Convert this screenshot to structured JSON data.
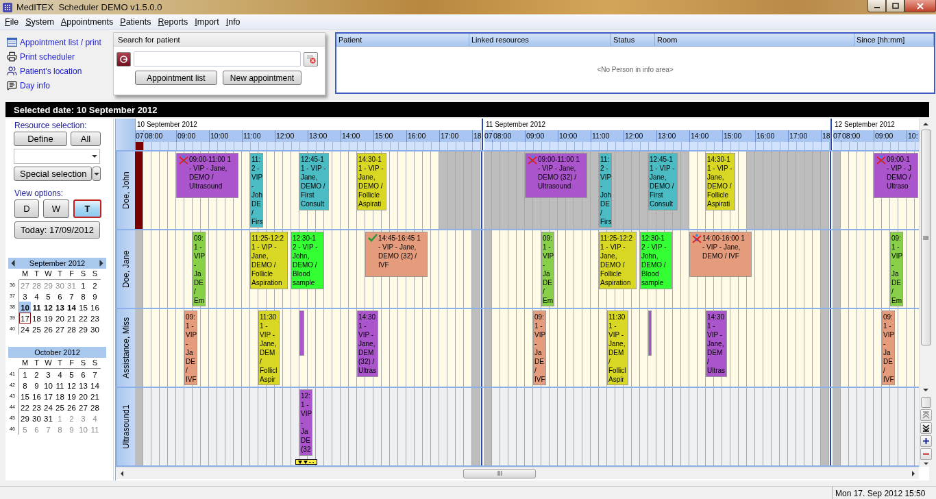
{
  "window": {
    "title": "MedITEX  Scheduler DEMO v1.5.0.0"
  },
  "menu": [
    "File",
    "System",
    "Appointments",
    "Patients",
    "Reports",
    "Import",
    "Info"
  ],
  "quick_links": [
    "Appointment list / print",
    "Print scheduler",
    "Patient's location",
    "Day info"
  ],
  "search": {
    "title": "Search for patient",
    "buttons": [
      "Appointment list",
      "New appointment"
    ]
  },
  "info_table": {
    "columns": [
      "Patient",
      "Linked resources",
      "Status",
      "Room",
      "Since [hh:mm]"
    ],
    "empty_text": "<No Person in info area>"
  },
  "selected_date": "Selected date: 10 September 2012",
  "resource_selection": {
    "label": "Resource selection:",
    "buttons": [
      "Define",
      "All"
    ],
    "special": "Special selection"
  },
  "view_options": {
    "label": "View options:",
    "buttons": [
      {
        "label": "D",
        "selected": false
      },
      {
        "label": "W",
        "selected": false
      },
      {
        "label": "T",
        "selected": true
      }
    ],
    "today": "Today: 17/09/2012"
  },
  "calendars": [
    {
      "title": "September 2012",
      "arrows": true,
      "weekdays": [
        "M",
        "T",
        "W",
        "T",
        "F",
        "S",
        "S"
      ],
      "weeks": [
        {
          "week": "36",
          "days": [
            {
              "d": "27",
              "muted": true,
              "selected": false
            },
            {
              "d": "28",
              "muted": true,
              "selected": false
            },
            {
              "d": "29",
              "muted": true,
              "selected": false
            },
            {
              "d": "30",
              "muted": true,
              "selected": false
            },
            {
              "d": "31",
              "muted": true,
              "selected": false
            },
            {
              "d": "1",
              "selected": false
            },
            {
              "d": "2",
              "selected": false
            }
          ]
        },
        {
          "week": "37",
          "days": [
            {
              "d": "3",
              "selected": false
            },
            {
              "d": "4",
              "selected": false
            },
            {
              "d": "5",
              "selected": false
            },
            {
              "d": "6",
              "selected": false
            },
            {
              "d": "7",
              "selected": false
            },
            {
              "d": "8",
              "selected": false
            },
            {
              "d": "9",
              "selected": false
            }
          ]
        },
        {
          "week": "38",
          "days": [
            {
              "d": "10",
              "bold": true,
              "selected": true
            },
            {
              "d": "11",
              "bold": true,
              "selected": false
            },
            {
              "d": "12",
              "bold": true,
              "selected": false
            },
            {
              "d": "13",
              "bold": true,
              "selected": false
            },
            {
              "d": "14",
              "bold": true,
              "selected": false
            },
            {
              "d": "15",
              "selected": false
            },
            {
              "d": "16",
              "selected": false
            }
          ]
        },
        {
          "week": "39",
          "days": [
            {
              "d": "17",
              "today": true,
              "selected": false
            },
            {
              "d": "18",
              "selected": false
            },
            {
              "d": "19",
              "selected": false
            },
            {
              "d": "20",
              "selected": false
            },
            {
              "d": "21",
              "selected": false
            },
            {
              "d": "22",
              "selected": false
            },
            {
              "d": "23",
              "selected": false
            }
          ]
        },
        {
          "week": "40",
          "days": [
            {
              "d": "24",
              "selected": false
            },
            {
              "d": "25",
              "selected": false
            },
            {
              "d": "26",
              "selected": false
            },
            {
              "d": "27",
              "selected": false
            },
            {
              "d": "28",
              "selected": false
            },
            {
              "d": "29",
              "selected": false
            },
            {
              "d": "30",
              "selected": false
            }
          ]
        }
      ]
    },
    {
      "title": "October 2012",
      "arrows": false,
      "weekdays": [
        "M",
        "T",
        "W",
        "T",
        "F",
        "S",
        "S"
      ],
      "weeks": [
        {
          "week": "41",
          "days": [
            {
              "d": "1",
              "selected": false
            },
            {
              "d": "2",
              "selected": false
            },
            {
              "d": "3",
              "selected": false
            },
            {
              "d": "4",
              "selected": false
            },
            {
              "d": "5",
              "selected": false
            },
            {
              "d": "6",
              "selected": false
            },
            {
              "d": "7",
              "selected": false
            }
          ]
        },
        {
          "week": "42",
          "days": [
            {
              "d": "8",
              "selected": false
            },
            {
              "d": "9",
              "selected": false
            },
            {
              "d": "10",
              "selected": false
            },
            {
              "d": "11",
              "selected": false
            },
            {
              "d": "12",
              "selected": false
            },
            {
              "d": "13",
              "selected": false
            },
            {
              "d": "14",
              "selected": false
            }
          ]
        },
        {
          "week": "43",
          "days": [
            {
              "d": "15",
              "selected": false
            },
            {
              "d": "16",
              "selected": false
            },
            {
              "d": "17",
              "selected": false
            },
            {
              "d": "18",
              "selected": false
            },
            {
              "d": "19",
              "selected": false
            },
            {
              "d": "20",
              "selected": false
            },
            {
              "d": "21",
              "selected": false
            }
          ]
        },
        {
          "week": "44",
          "days": [
            {
              "d": "22",
              "selected": false
            },
            {
              "d": "23",
              "selected": false
            },
            {
              "d": "24",
              "selected": false
            },
            {
              "d": "25",
              "selected": false
            },
            {
              "d": "26",
              "selected": false
            },
            {
              "d": "27",
              "selected": false
            },
            {
              "d": "28",
              "selected": false
            }
          ]
        },
        {
          "week": "45",
          "days": [
            {
              "d": "29",
              "selected": false
            },
            {
              "d": "30",
              "selected": false
            },
            {
              "d": "31",
              "selected": false
            },
            {
              "d": "1",
              "muted": true,
              "selected": false
            },
            {
              "d": "2",
              "muted": true,
              "selected": false
            },
            {
              "d": "3",
              "muted": true,
              "selected": false
            },
            {
              "d": "4",
              "muted": true,
              "selected": false
            }
          ]
        },
        {
          "week": "46",
          "days": [
            {
              "d": "5",
              "muted": true,
              "selected": false
            },
            {
              "d": "6",
              "muted": true,
              "selected": false
            },
            {
              "d": "7",
              "muted": true,
              "selected": false
            },
            {
              "d": "8",
              "muted": true,
              "selected": false
            },
            {
              "d": "9",
              "muted": true,
              "selected": false
            },
            {
              "d": "10",
              "muted": true,
              "selected": false
            },
            {
              "d": "11",
              "muted": true,
              "selected": false
            }
          ]
        }
      ]
    }
  ],
  "scheduler": {
    "days": [
      {
        "label": "10 September 2012",
        "marked": true,
        "hours": [
          "07",
          "08:00",
          "09:00",
          "10:00",
          "11:00",
          "12:00",
          "13:00",
          "14:00",
          "15:00",
          "16:00",
          "17:00",
          "18"
        ]
      },
      {
        "label": "11 September 2012",
        "marked": false,
        "hours": [
          "07",
          "08:00",
          "09:00",
          "10:00",
          "11:00",
          "12:00",
          "13:00",
          "14:00",
          "15:00",
          "16:00",
          "17:00",
          "18"
        ]
      },
      {
        "label": "12 September 2012",
        "marked": false,
        "hours": [
          "07",
          "08:00",
          "09:00",
          "10:"
        ]
      }
    ],
    "resources": [
      {
        "name": "Doe, John",
        "kind": "person",
        "days": [
          {
            "marker": true,
            "appointments": [
              {
                "kind": "cancelled",
                "color": "#aa55cc",
                "text": "09:00-11:00 1\n- VIP - Jane,\nDEMO /\nUltrasound"
              },
              {
                "kind": "plain",
                "color": "#4cbcc4",
                "text": "11:\n2 -\nVIP\n-\nJoh\nDE\n/\nFirs"
              },
              {
                "kind": "plain",
                "color": "#4cbcc4",
                "text": "12:45-1\n1 - VIP -\nJane,\nDEMO /\nFirst\nConsult"
              },
              {
                "kind": "plain",
                "color": "#d8d824",
                "text": "14:30-1\n1 - VIP -\nJane,\nDEMO /\nFollicle\nAspirati"
              }
            ]
          },
          {
            "marker": false,
            "appointments": [
              {
                "kind": "cancelled",
                "color": "#aa55cc",
                "text": "09:00-11:00 1\n- VIP - Jane,\nDEMO (32) /\nUltrasound"
              },
              {
                "kind": "plain",
                "color": "#4cbcc4",
                "text": "11:\n2 -\nVIP\n-\nJoh\nDE\n/\nFirs"
              },
              {
                "kind": "plain",
                "color": "#4cbcc4",
                "text": "12:45-1\n1 - VIP -\nJane,\nDEMO /\nFirst\nConsult"
              },
              {
                "kind": "plain",
                "color": "#d8d824",
                "text": "14:30-1\n1 - VIP -\nJane,\nDEMO /\nFollicle\nAspirati"
              }
            ]
          },
          {
            "marker": false,
            "appointments": [
              {
                "kind": "cancelled",
                "color": "#aa55cc",
                "text": "09:00-1\n- VIP - J\nDEMO /\nUltraso"
              }
            ]
          }
        ]
      },
      {
        "name": "Doe, Jane",
        "kind": "person",
        "days": [
          {
            "marker": false,
            "appointments": [
              {
                "kind": "plain",
                "color": "#88d048",
                "text": "09:\n1 -\nVIP\n-\nJa\nDE\n/\nEm"
              },
              {
                "kind": "plain",
                "color": "#d8d824",
                "text": "11:25-12:2\n1 - VIP -\nJane,\nDEMO /\nFollicle\nAspiration"
              },
              {
                "kind": "plain",
                "color": "#33ff33",
                "text": "12:30-1\n2 - VIP -\nJohn,\nDEMO /\nBlood\nsample"
              },
              {
                "kind": "done",
                "color": "#e49c7c",
                "text": "14:45-16:45 1\n- VIP - Jane,\nDEMO (32) /\nIVF"
              }
            ]
          },
          {
            "marker": false,
            "appointments": [
              {
                "kind": "plain",
                "color": "#88d048",
                "text": "09:\n1 -\nVIP\n-\nJa\nDE\n/\nEm"
              },
              {
                "kind": "plain",
                "color": "#d8d824",
                "text": "11:25-12:2\n1 - VIP -\nJane,\nDEMO /\nFollicle\nAspiration"
              },
              {
                "kind": "plain",
                "color": "#33ff33",
                "text": "12:30-1\n2 - VIP -\nJohn,\nDEMO /\nBlood\nsample"
              },
              {
                "kind": "cancelled",
                "color": "#e49c7c",
                "text": "14:00-16:00 1\n- VIP - Jane,\nDEMO / IVF"
              }
            ]
          },
          {
            "marker": false,
            "appointments": [
              {
                "kind": "plain",
                "color": "#88d048",
                "text": "09:\n1 -\nVIP\n-\nJa\nDE\n/\nEm"
              }
            ]
          }
        ]
      },
      {
        "name": "Assistance, Miss",
        "kind": "person",
        "days": [
          {
            "marker": false,
            "appointments": [
              {
                "kind": "plain",
                "color": "#e49c7c",
                "text": "09:\n1 -\nVIP\n-\nJa\nDE\n/\nIVF"
              },
              {
                "kind": "plain",
                "color": "#d8d824",
                "text": "11:30\n1 -\nVIP -\nJane,\nDEM\n/\nFollicl\nAspir"
              },
              {
                "kind": "plain",
                "color": "#aa55cc"
              },
              {
                "kind": "plain",
                "color": "#aa55cc",
                "text": "14:30\n1 -\nVIP -\nJane,\nDEM\n(32) /\nUltras"
              }
            ]
          },
          {
            "marker": false,
            "appointments": [
              {
                "kind": "plain",
                "color": "#e49c7c",
                "text": "09:\n1 -\nVIP\n-\nJa\nDE\n/\nIVF"
              },
              {
                "kind": "plain",
                "color": "#d8d824",
                "text": "11:30\n1 -\nVIP -\nJane,\nDEM\n/\nFollicl\nAspir"
              },
              {
                "kind": "plain",
                "color": "#aa55cc"
              },
              {
                "kind": "plain",
                "color": "#aa55cc",
                "text": "14:30\n1 -\nVIP -\nJane,\nDEM\n/\nUltras"
              }
            ]
          },
          {
            "marker": false,
            "appointments": [
              {
                "kind": "plain",
                "color": "#e49c7c",
                "text": "09:\n1 -\nVIP\n-\nJa\nDE\n/\nIVF"
              }
            ]
          }
        ]
      },
      {
        "name": "Ultrasound1",
        "kind": "room",
        "days": [
          {
            "marker": false,
            "appointments": [
              {
                "kind": "plain",
                "color": "#aa55cc",
                "more": true,
                "text": "12:\n1 -\nVIP\n-\nJa\nDE\n(32"
              }
            ]
          },
          {
            "marker": false
          },
          {
            "marker": false
          }
        ]
      }
    ]
  },
  "status_bar": {
    "datetime": "Mon 17. Sep 2012 15:50"
  }
}
